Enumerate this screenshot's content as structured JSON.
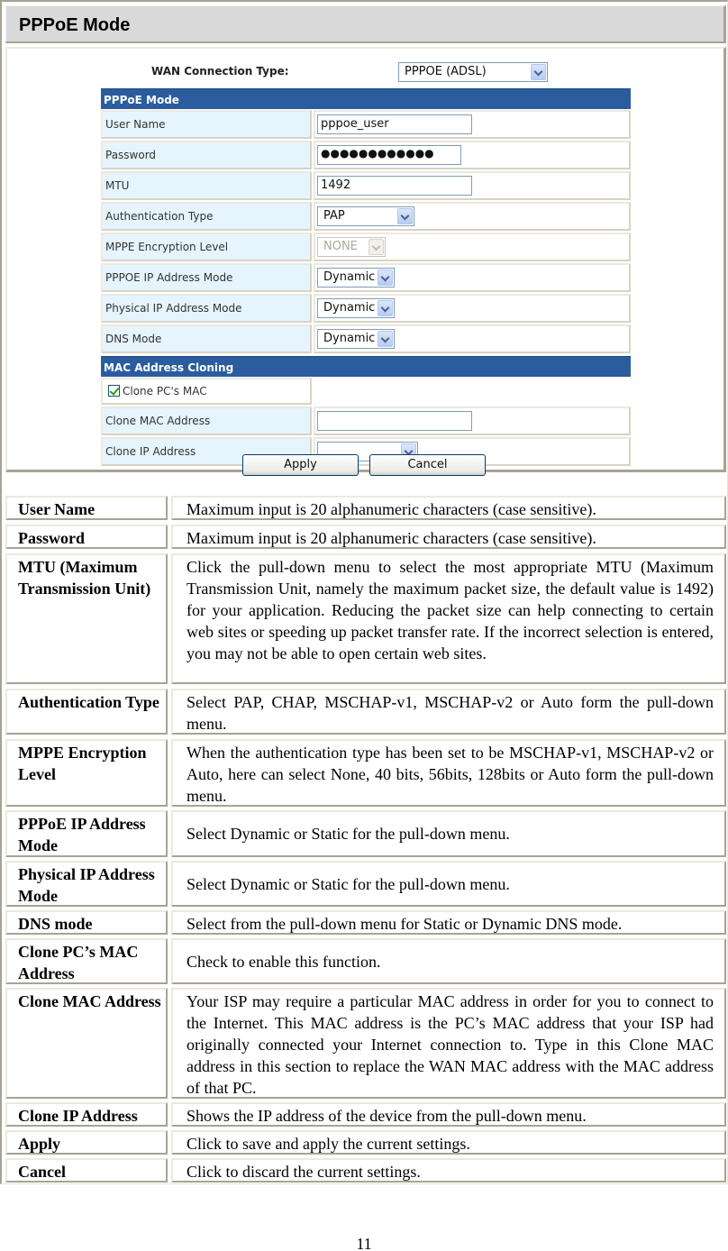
{
  "section_title": "PPPoE Mode",
  "router_ui": {
    "wan_connection_type_label": "WAN Connection Type:",
    "wan_connection_type_value": "PPPOE (ADSL)",
    "pppoe_section_title": "PPPoE Mode",
    "fields": {
      "user_name": {
        "label": "User Name",
        "value": "pppoe_user"
      },
      "password": {
        "label": "Password",
        "value": "●●●●●●●●●●●●"
      },
      "mtu": {
        "label": "MTU",
        "value": "1492"
      },
      "auth_type": {
        "label": "Authentication Type",
        "value": "PAP"
      },
      "mppe": {
        "label": "MPPE Encryption Level",
        "value": "NONE"
      },
      "pppoe_ip_mode": {
        "label": "PPPOE IP Address Mode",
        "value": "Dynamic"
      },
      "physical_ip_mode": {
        "label": "Physical IP Address Mode",
        "value": "Dynamic"
      },
      "dns_mode": {
        "label": "DNS Mode",
        "value": "Dynamic"
      }
    },
    "mac_section_title": "MAC Address Cloning",
    "clone_pc_mac": {
      "label": "Clone PC's MAC",
      "checked": true
    },
    "clone_mac_address": {
      "label": "Clone MAC Address",
      "value": ""
    },
    "clone_ip_address": {
      "label": "Clone IP Address",
      "value": ""
    },
    "apply_label": "Apply",
    "cancel_label": "Cancel"
  },
  "descriptions": [
    {
      "term": "User Name",
      "text": "Maximum input is 20 alphanumeric characters (case sensitive)."
    },
    {
      "term": "Password",
      "text": "Maximum input is 20 alphanumeric characters (case sensitive)."
    },
    {
      "term": "MTU (Maximum Transmission Unit)",
      "text": "Click the pull-down menu to select the most appropriate MTU (Maximum Transmission Unit, namely the maximum packet size, the default value is 1492) for your application. Reducing the packet size can help connecting to certain web sites or speeding up packet transfer rate. If the incorrect selection is entered, you may not be able to open certain web sites."
    },
    {
      "term": "Authentication Type",
      "text": "Select PAP, CHAP, MSCHAP-v1, MSCHAP-v2 or Auto form the pull-down menu."
    },
    {
      "term": "MPPE Encryption Level",
      "text": "When the authentication type has been set to be MSCHAP-v1, MSCHAP-v2 or Auto, here can select None, 40 bits, 56bits, 128bits or Auto form the pull-down menu."
    },
    {
      "term": "PPPoE IP Address Mode",
      "text": "Select Dynamic or Static for the pull-down menu."
    },
    {
      "term": "Physical IP Address Mode",
      "text": "Select Dynamic or Static for the pull-down menu."
    },
    {
      "term": "DNS mode",
      "text": "Select from the pull-down menu for Static or Dynamic DNS mode."
    },
    {
      "term": "Clone PC’s MAC Address",
      "text": "Check to enable this function."
    },
    {
      "term": "Clone MAC Address",
      "text": "Your ISP may require a particular MAC address in order for you to connect to the Internet. This MAC address is the PC’s MAC address that your ISP had originally connected your Internet connection to. Type in this Clone MAC address in this section to replace the WAN MAC address with the MAC address of that PC."
    },
    {
      "term": "Clone IP Address",
      "text": "Shows the IP address of the device from the pull-down menu."
    },
    {
      "term": "Apply",
      "text": "Click to save and apply the current settings."
    },
    {
      "term": "Cancel",
      "text": "Click to discard the current settings."
    }
  ],
  "page_number": "11"
}
